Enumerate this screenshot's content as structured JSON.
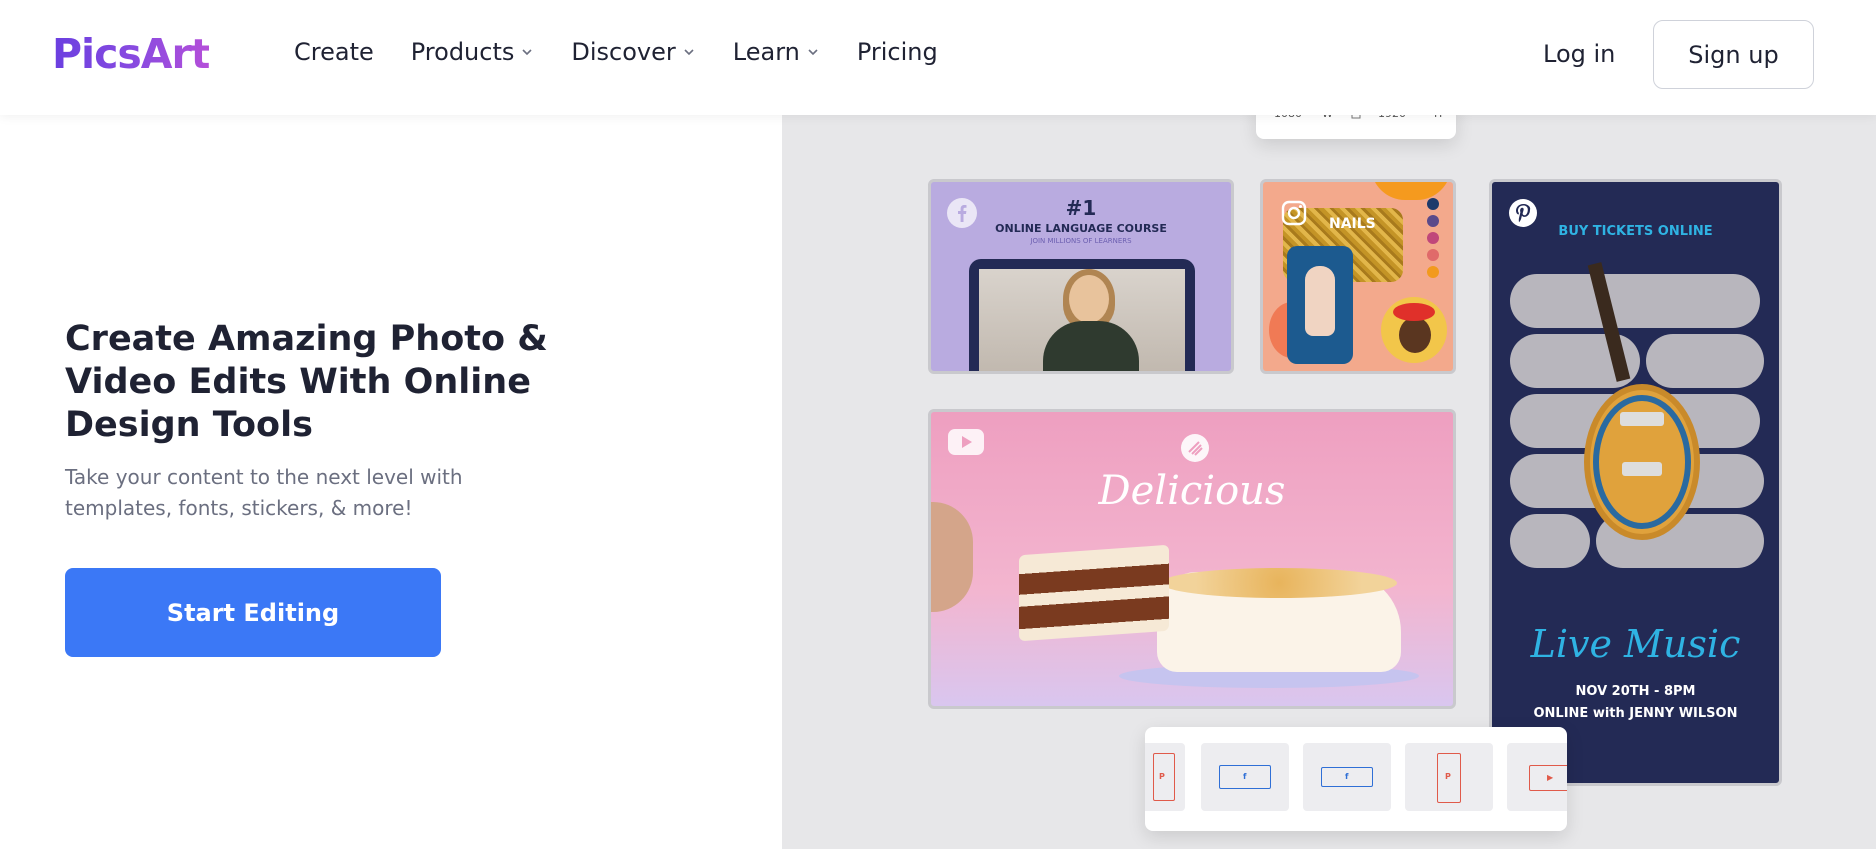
{
  "brand": {
    "logo_text": "PicsArt",
    "logo_gradient": [
      "#6a3fe0",
      "#b54fd9"
    ]
  },
  "nav": {
    "items": [
      {
        "label": "Create",
        "has_dropdown": false
      },
      {
        "label": "Products",
        "has_dropdown": true
      },
      {
        "label": "Discover",
        "has_dropdown": true
      },
      {
        "label": "Learn",
        "has_dropdown": true
      },
      {
        "label": "Pricing",
        "has_dropdown": false
      }
    ],
    "login_label": "Log in",
    "signup_label": "Sign up"
  },
  "hero": {
    "title": "Create Amazing Photo & Video Edits With Online Design Tools",
    "subtitle": "Take your content to the next level with templates, fonts, stickers, & more!",
    "cta_label": "Start Editing",
    "cta_color": "#3b78f6"
  },
  "showcase": {
    "size_bar": {
      "width_value": "1080",
      "width_unit": "W",
      "height_value": "1920",
      "height_unit": "H"
    },
    "facebook_card": {
      "icon": "facebook-icon",
      "headline": "#1",
      "title": "ONLINE LANGUAGE COURSE",
      "subtitle": "JOIN MILLIONS OF LEARNERS"
    },
    "instagram_card": {
      "icon": "instagram-icon",
      "title": "NAILS",
      "swatches": [
        "#1d3a6b",
        "#5a4a8a",
        "#c0477a",
        "#e06a6a",
        "#f29a1e"
      ]
    },
    "youtube_card": {
      "icon": "youtube-icon",
      "title": "Delicious"
    },
    "pinterest_card": {
      "icon": "pinterest-icon",
      "headline": "BUY TICKETS ONLINE",
      "title": "Live Music",
      "date": "NOV 20TH - 8PM",
      "host": "ONLINE with JENNY WILSON"
    },
    "format_bar": {
      "formats": [
        {
          "icon": "pinterest-icon",
          "color": "#e05a4a",
          "glyph": "P"
        },
        {
          "icon": "facebook-icon",
          "color": "#2f6fd6",
          "glyph": "f"
        },
        {
          "icon": "facebook-icon",
          "color": "#2f6fd6",
          "glyph": "f"
        },
        {
          "icon": "pinterest-icon",
          "color": "#e05a4a",
          "glyph": "P"
        },
        {
          "icon": "youtube-icon",
          "color": "#e05a4a",
          "glyph": "▶"
        }
      ]
    }
  }
}
